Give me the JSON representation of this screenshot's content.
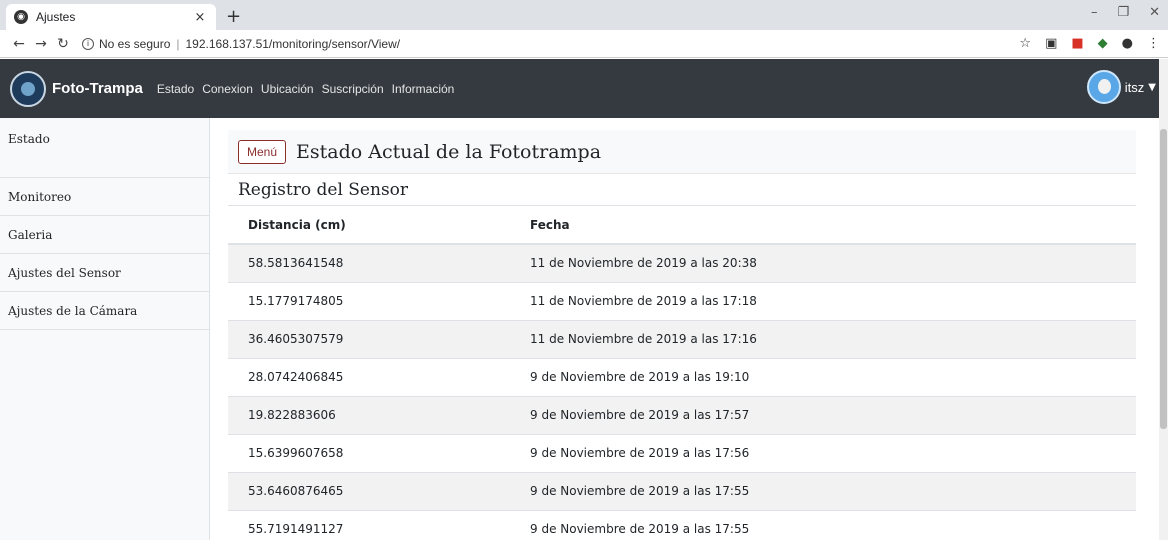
{
  "browser": {
    "tab_title": "Ajustes",
    "tab_close": "×",
    "new_tab": "+",
    "url_insecure": "No es seguro",
    "url": "192.168.137.51/monitoring/sensor/View/"
  },
  "navbar": {
    "brand": "Foto-Trampa",
    "items": [
      "Estado",
      "Conexion",
      "Ubicación",
      "Suscripción",
      "Información"
    ],
    "user": "itsz"
  },
  "sidebar": {
    "items": [
      "Estado",
      "Monitoreo",
      "Galeria",
      "Ajustes del Sensor",
      "Ajustes de la Cámara"
    ]
  },
  "main": {
    "menu_button": "Menú",
    "page_title": "Estado Actual de la Fototrampa",
    "section_title": "Registro del Sensor",
    "table": {
      "headers": [
        "Distancia (cm)",
        "Fecha"
      ],
      "rows": [
        [
          "58.5813641548",
          "11 de Noviembre de 2019 a las 20:38"
        ],
        [
          "15.1779174805",
          "11 de Noviembre de 2019 a las 17:18"
        ],
        [
          "36.4605307579",
          "11 de Noviembre de 2019 a las 17:16"
        ],
        [
          "28.0742406845",
          "9 de Noviembre de 2019 a las 19:10"
        ],
        [
          "19.822883606",
          "9 de Noviembre de 2019 a las 17:57"
        ],
        [
          "15.6399607658",
          "9 de Noviembre de 2019 a las 17:56"
        ],
        [
          "53.6460876465",
          "9 de Noviembre de 2019 a las 17:55"
        ],
        [
          "55.7191491127",
          "9 de Noviembre de 2019 a las 17:55"
        ]
      ]
    }
  },
  "colors": {
    "navbar_bg": "#343a40",
    "menu_button_border": "#8b2e2e",
    "row_stripe": "#f2f2f2"
  }
}
